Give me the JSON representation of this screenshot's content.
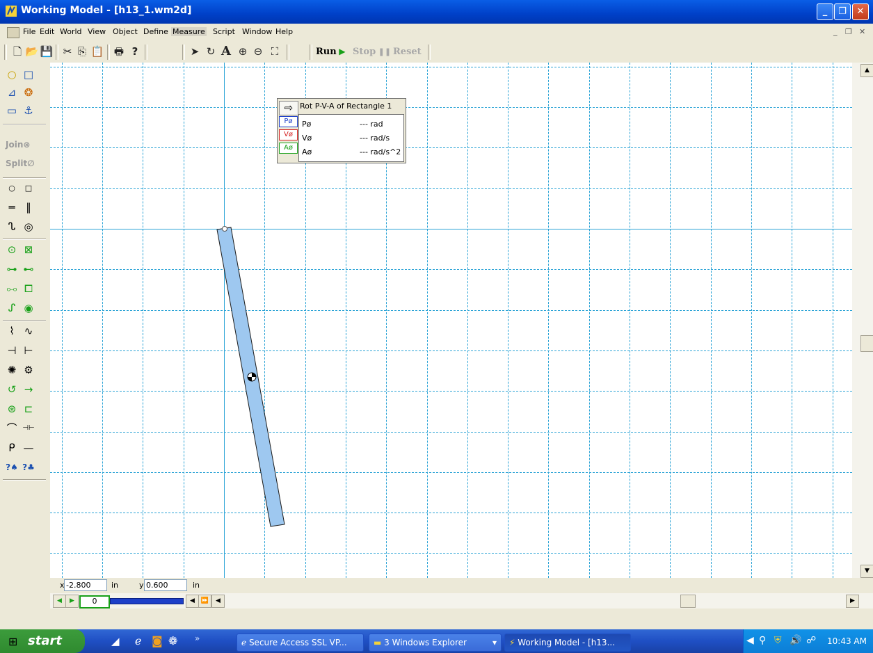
{
  "window": {
    "title": "Working Model - [h13_1.wm2d]",
    "min": "_",
    "max": "❐",
    "close": "✕"
  },
  "menu": {
    "items": [
      "File",
      "Edit",
      "World",
      "View",
      "Object",
      "Define",
      "Measure",
      "Script",
      "Window",
      "Help"
    ],
    "doc_min": "_",
    "doc_restore": "❐",
    "doc_close": "✕"
  },
  "toolbar": {
    "run_label": "Run",
    "stop_label": "Stop",
    "reset_label": "Reset"
  },
  "palette": {
    "join_label": "Join",
    "split_label": "Split"
  },
  "meter": {
    "title": "Rot P-V-A of Rectangle 1",
    "rows": [
      {
        "badge": "Pø",
        "label": "Pø",
        "value": "--- rad",
        "color": "#1d3fc8"
      },
      {
        "badge": "Vø",
        "label": "Vø",
        "value": "--- rad/s",
        "color": "#d42020"
      },
      {
        "badge": "Aø",
        "label": "Aø",
        "value": "--- rad/s^2",
        "color": "#18a018"
      }
    ]
  },
  "coords": {
    "x_label": "x",
    "x_value": "-2.800",
    "x_unit": "in",
    "y_label": "y",
    "y_value": "0.600",
    "y_unit": "in"
  },
  "playback": {
    "frame": "0"
  },
  "taskbar": {
    "start_label": "start",
    "tasks": [
      {
        "label": "Secure Access SSL VP...",
        "icon": "ie-icon"
      },
      {
        "label": "3 Windows Explorer",
        "icon": "folder-icon"
      },
      {
        "label": "Working Model - [h13...",
        "icon": "working-model-icon"
      }
    ],
    "clock": "10:43 AM"
  },
  "colors": {
    "grid": "#2aa3d6",
    "body_fill": "#9ec8f0",
    "titlebar": "#0a5ee6",
    "taskbar": "#245edb"
  }
}
